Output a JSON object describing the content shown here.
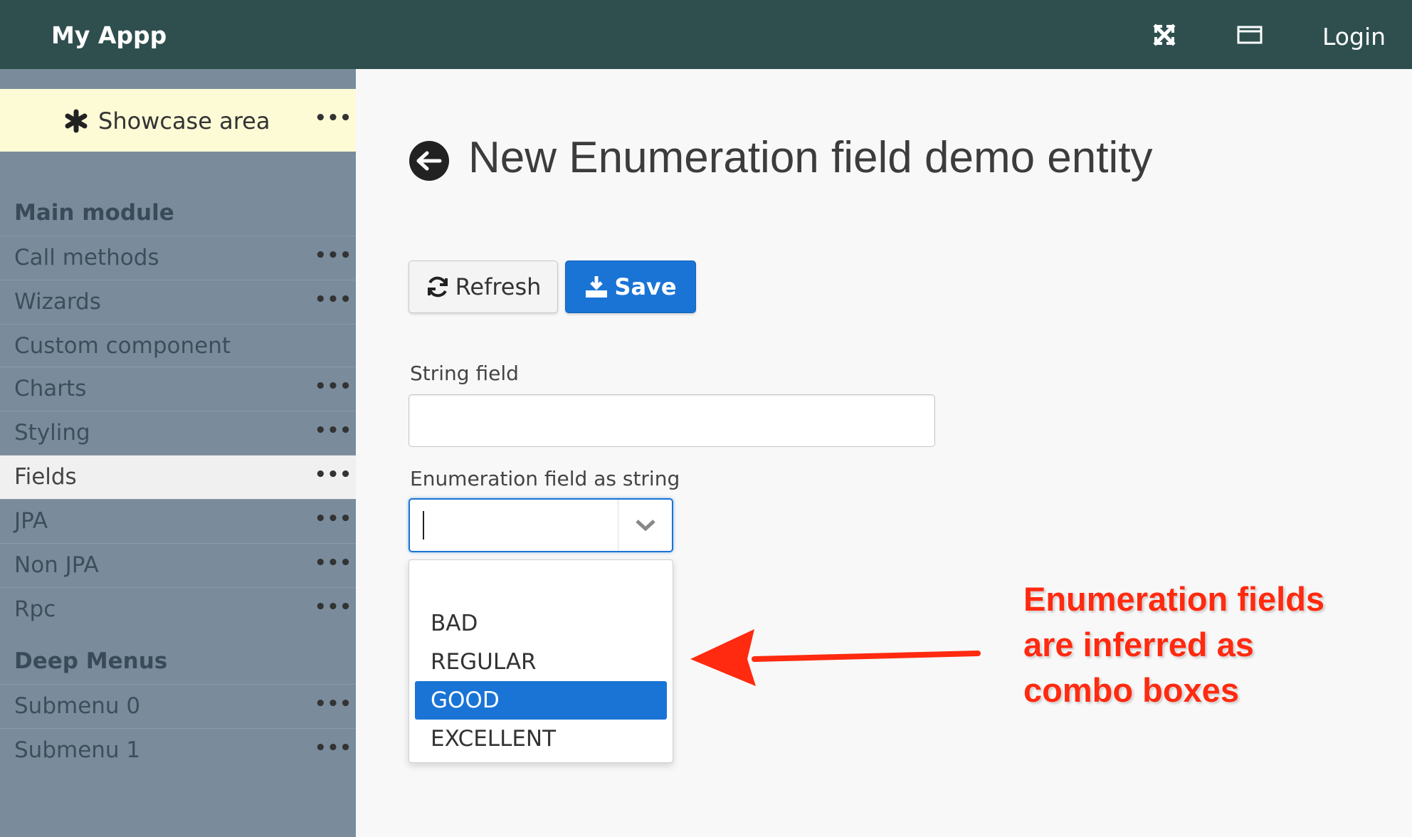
{
  "header": {
    "app_title": "My Appp",
    "login_label": "Login"
  },
  "sidebar": {
    "showcase_label": "Showcase area",
    "sections": [
      {
        "title": "Main module",
        "items": [
          {
            "label": "Call methods",
            "has_menu": true
          },
          {
            "label": "Wizards",
            "has_menu": true
          },
          {
            "label": "Custom component",
            "has_menu": false
          },
          {
            "label": "Charts",
            "has_menu": true
          },
          {
            "label": "Styling",
            "has_menu": true
          },
          {
            "label": "Fields",
            "has_menu": true,
            "active": true
          },
          {
            "label": "JPA",
            "has_menu": true
          },
          {
            "label": "Non JPA",
            "has_menu": true
          },
          {
            "label": "Rpc",
            "has_menu": true
          }
        ]
      },
      {
        "title": "Deep Menus",
        "items": [
          {
            "label": "Submenu 0",
            "has_menu": true
          },
          {
            "label": "Submenu 1",
            "has_menu": true
          }
        ]
      }
    ],
    "menu_dots": "•••"
  },
  "main": {
    "title": "New Enumeration field demo entity",
    "toolbar": {
      "refresh_label": "Refresh",
      "save_label": "Save"
    },
    "fields": {
      "string_label": "String field",
      "string_value": "",
      "enum_label": "Enumeration field as string",
      "enum_value": ""
    },
    "dropdown_options": [
      "",
      "BAD",
      "REGULAR",
      "GOOD",
      "EXCELLENT"
    ],
    "selected_option": "GOOD"
  },
  "annotation": {
    "lines": [
      "Enumeration fields",
      "are inferred as",
      "combo boxes"
    ],
    "color": "#ff2a10"
  },
  "colors": {
    "header_bg": "#2f4f4f",
    "sidebar_bg": "#7a8c9c",
    "showcase_bg": "#fdfad6",
    "accent": "#1a74d6"
  }
}
